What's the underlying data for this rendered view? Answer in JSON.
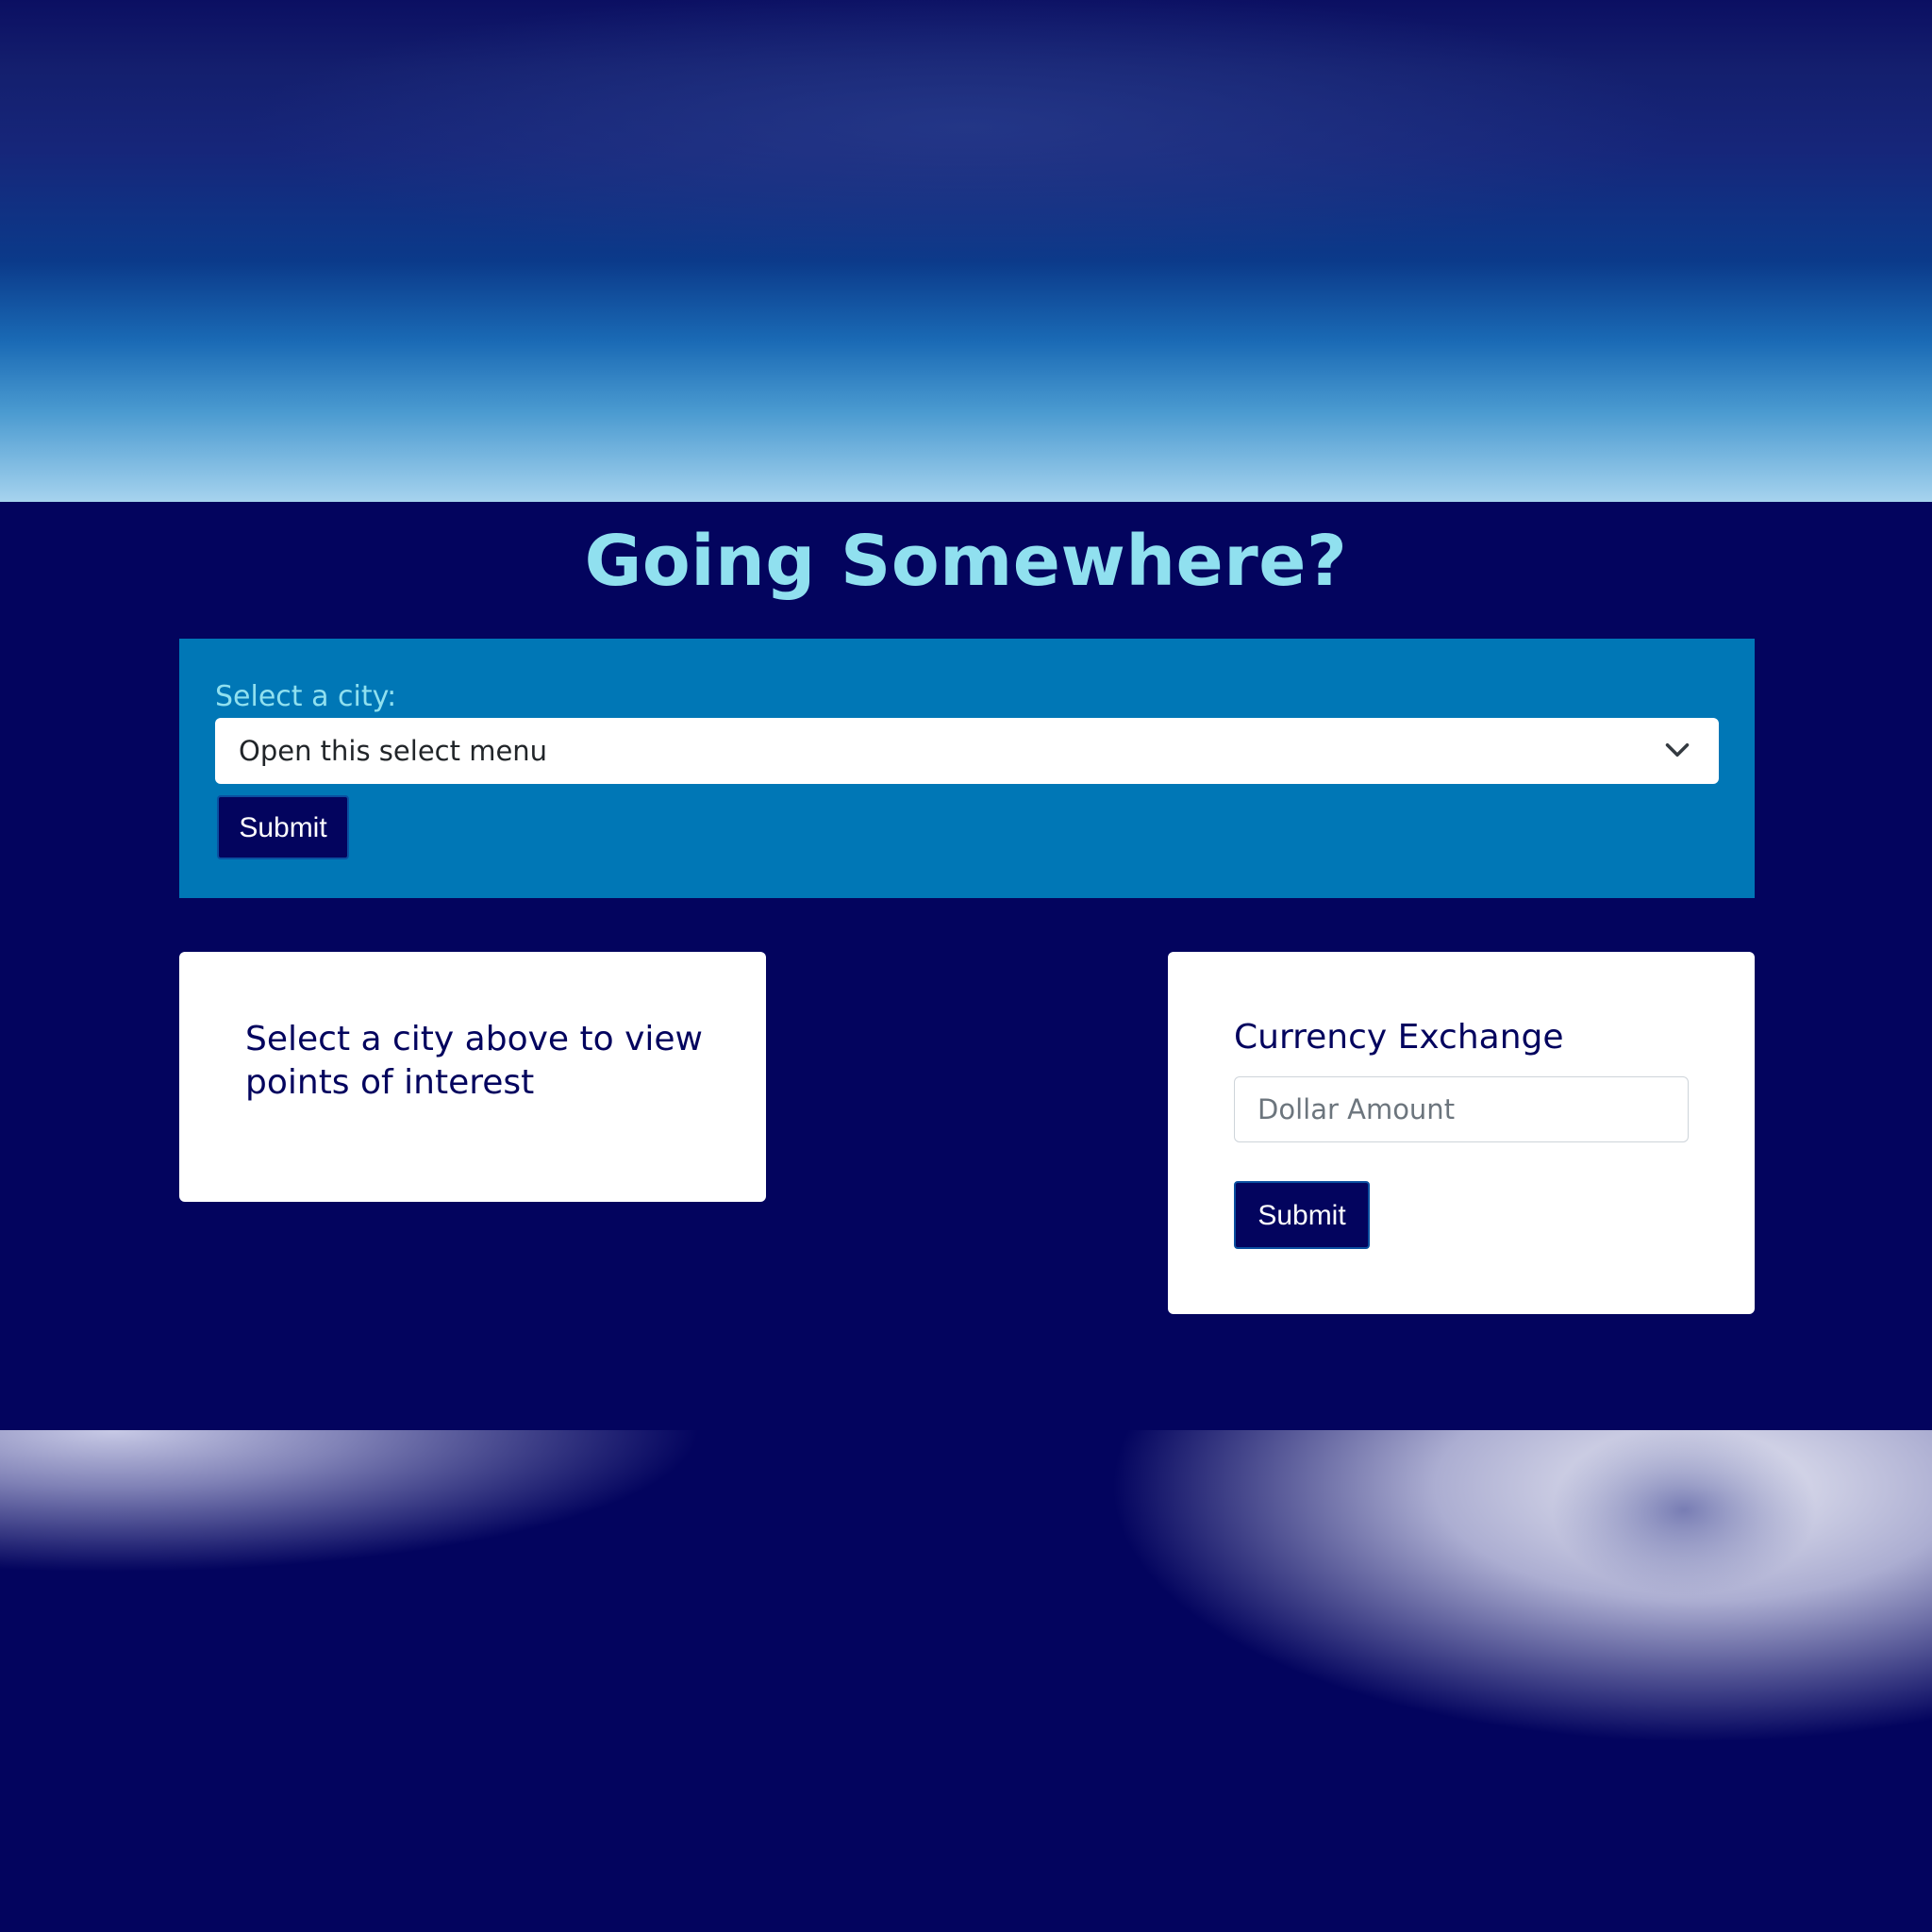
{
  "header": {
    "title": "Going Somewhere?"
  },
  "city_form": {
    "label": "Select a city:",
    "select_value": "Open this select menu",
    "submit_label": "Submit"
  },
  "poi_card": {
    "message": "Select a city above to view points of interest"
  },
  "currency_card": {
    "title": "Currency Exchange",
    "input_placeholder": "Dollar Amount",
    "submit_label": "Submit"
  },
  "icons": {
    "select_caret": "chevron-down-icon"
  },
  "colors": {
    "background": "#03045e",
    "panel": "#0077b6",
    "accent_text": "#90e0ef",
    "card": "#ffffff",
    "button": "#03045e"
  }
}
